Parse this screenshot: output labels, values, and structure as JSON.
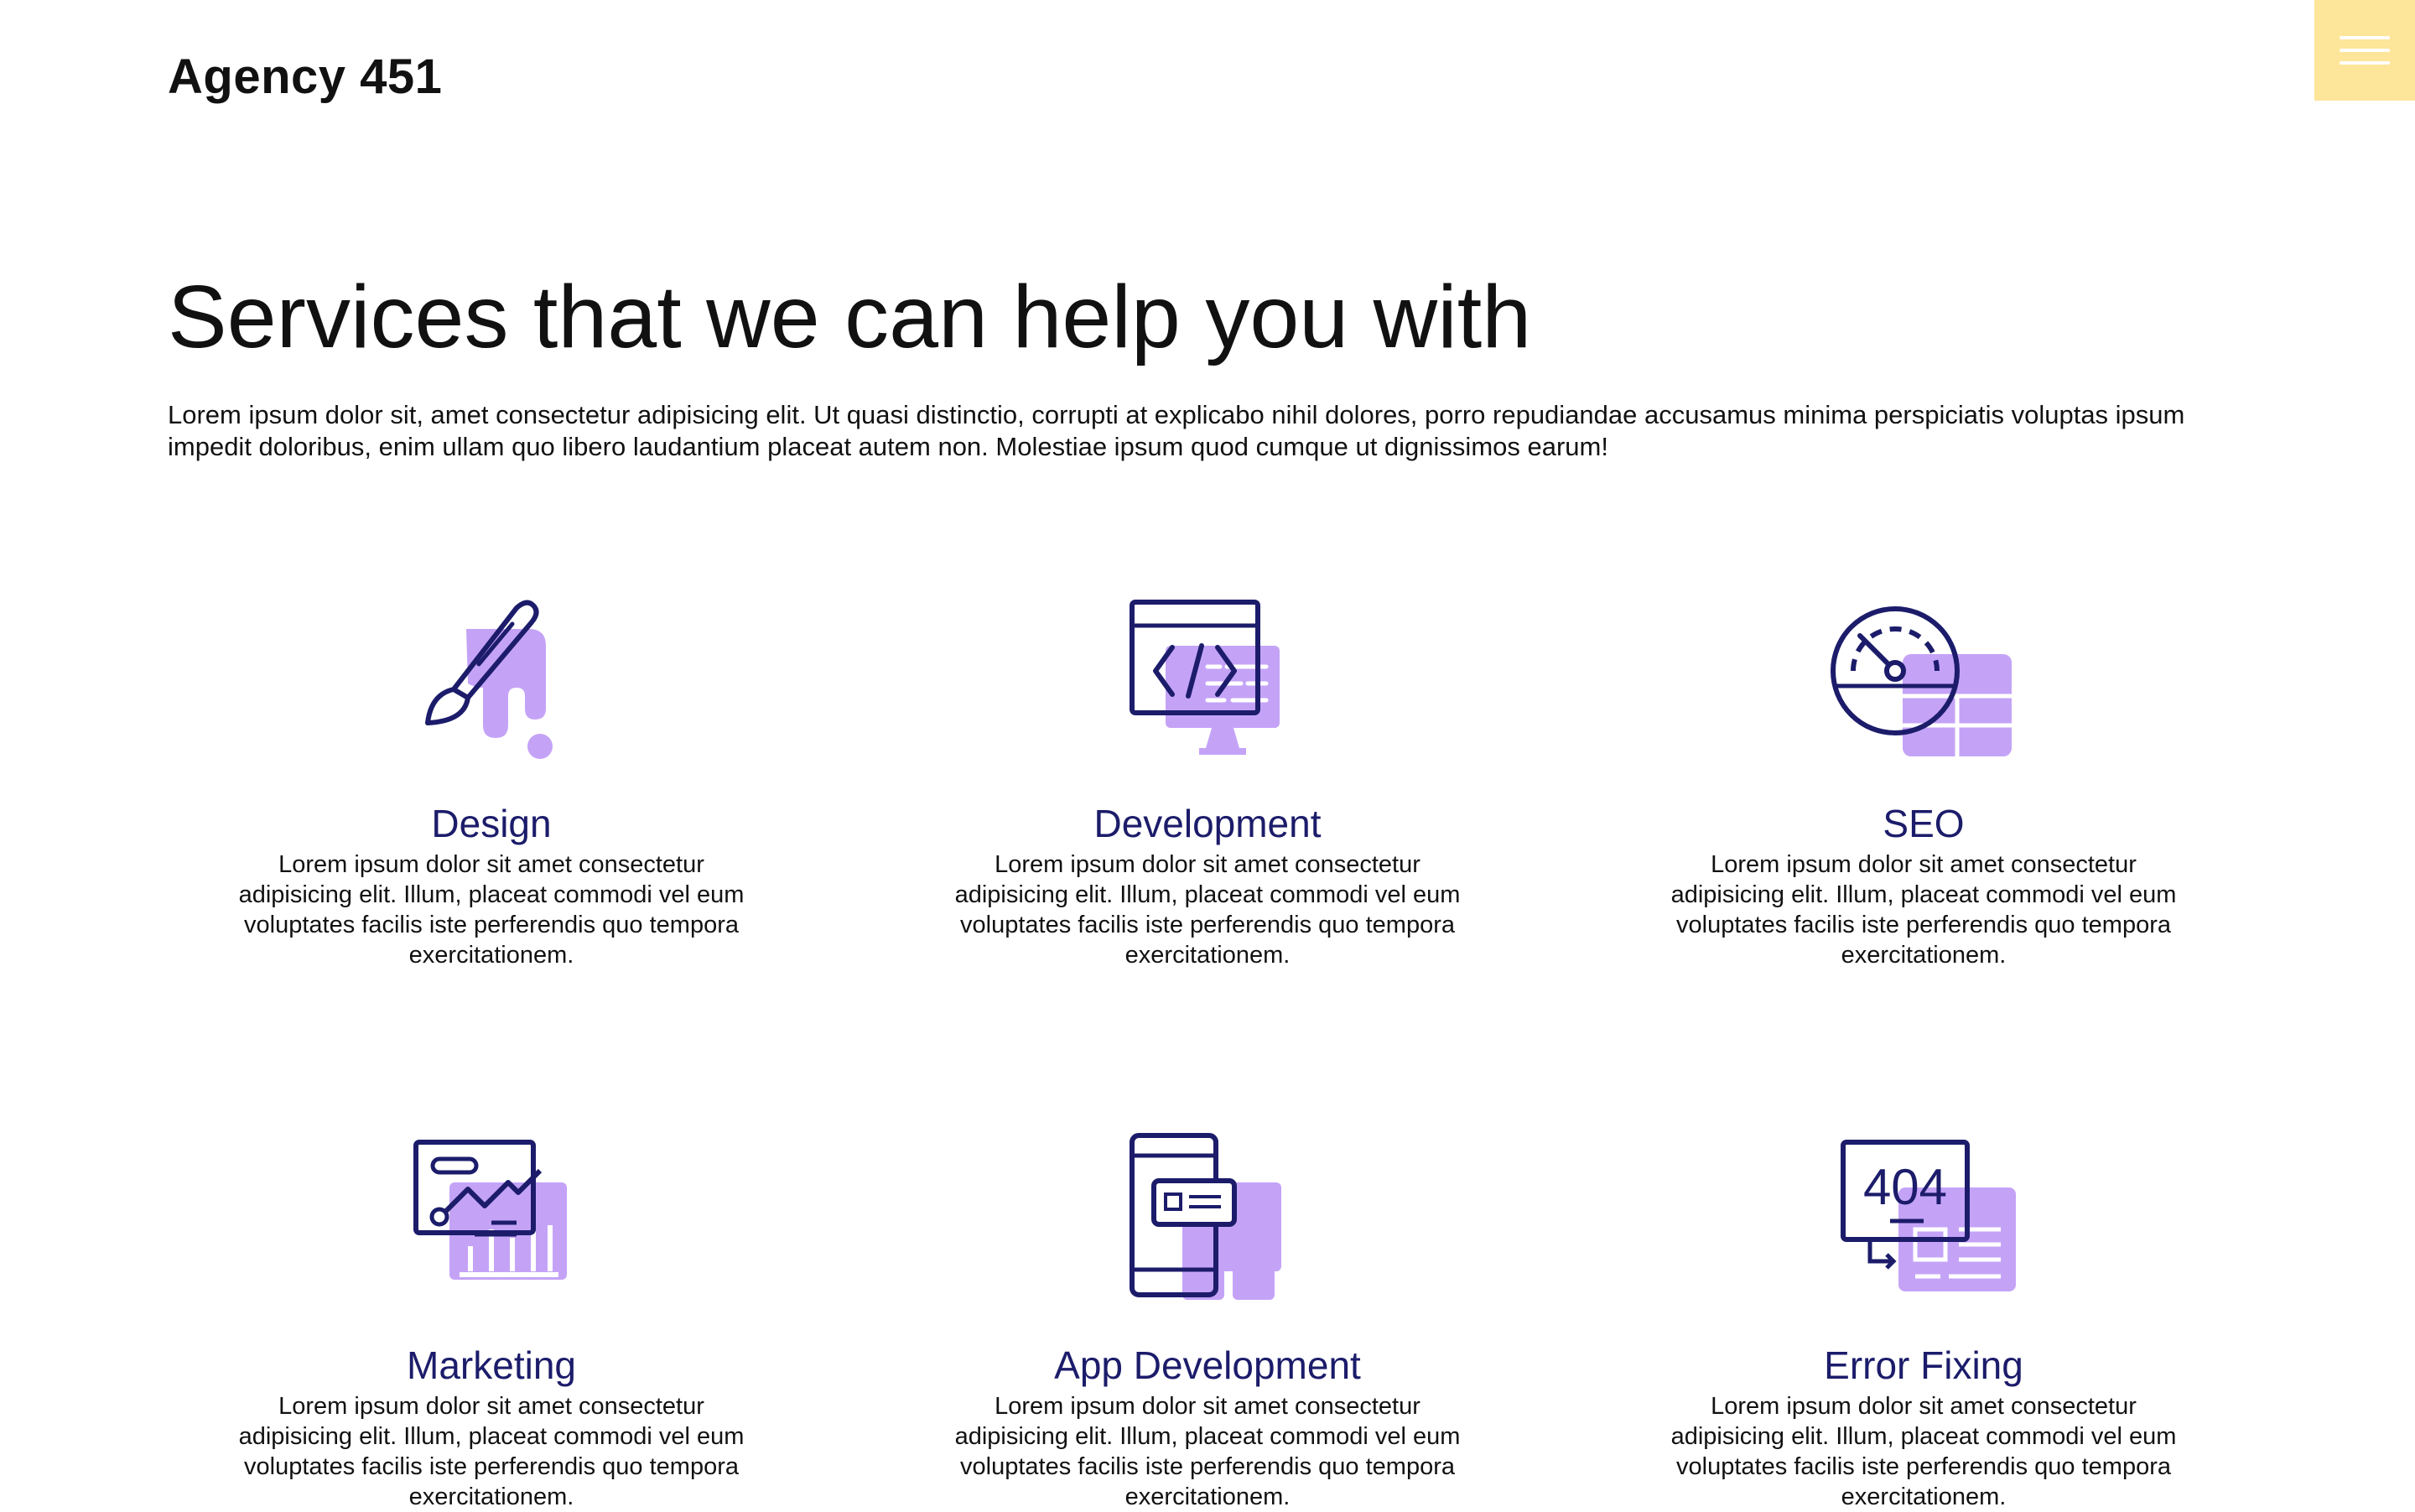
{
  "brand": {
    "name": "Agency 451"
  },
  "menu": {
    "icon": "hamburger-menu-icon",
    "background": "#fde59a"
  },
  "hero": {
    "title": "Services that we can help you with",
    "intro": "Lorem ipsum dolor sit, amet consectetur adipisicing elit. Ut quasi distinctio, corrupti at explicabo nihil dolores, porro repudiandae accusamus minima perspiciatis voluptas ipsum impedit doloribus, enim ullam quo libero laudantium placeat autem non. Molestiae ipsum quod cumque ut dignissimos earum!"
  },
  "colors": {
    "accent": "#c4a3f7",
    "ink": "#1c1c6b"
  },
  "services": [
    {
      "title": "Design",
      "icon": "paintbrush-icon",
      "desc": "Lorem ipsum dolor sit amet consectetur adipisicing elit. Illum, placeat commodi vel eum voluptates facilis iste perferendis quo tempora exercitationem."
    },
    {
      "title": "Development",
      "icon": "code-monitor-icon",
      "desc": "Lorem ipsum dolor sit amet consectetur adipisicing elit. Illum, placeat commodi vel eum voluptates facilis iste perferendis quo tempora exercitationem."
    },
    {
      "title": "SEO",
      "icon": "speedometer-icon",
      "desc": "Lorem ipsum dolor sit amet consectetur adipisicing elit. Illum, placeat commodi vel eum voluptates facilis iste perferendis quo tempora exercitationem."
    },
    {
      "title": "Marketing",
      "icon": "analytics-chart-icon",
      "desc": "Lorem ipsum dolor sit amet consectetur adipisicing elit. Illum, placeat commodi vel eum voluptates facilis iste perferendis quo tempora exercitationem."
    },
    {
      "title": "App Development",
      "icon": "mobile-app-icon",
      "desc": "Lorem ipsum dolor sit amet consectetur adipisicing elit. Illum, placeat commodi vel eum voluptates facilis iste perferendis quo tempora exercitationem."
    },
    {
      "title": "Error Fixing",
      "icon": "error-404-icon",
      "desc": "Lorem ipsum dolor sit amet consectetur adipisicing elit. Illum, placeat commodi vel eum voluptates facilis iste perferendis quo tempora exercitationem.",
      "icon_text": "404"
    }
  ]
}
